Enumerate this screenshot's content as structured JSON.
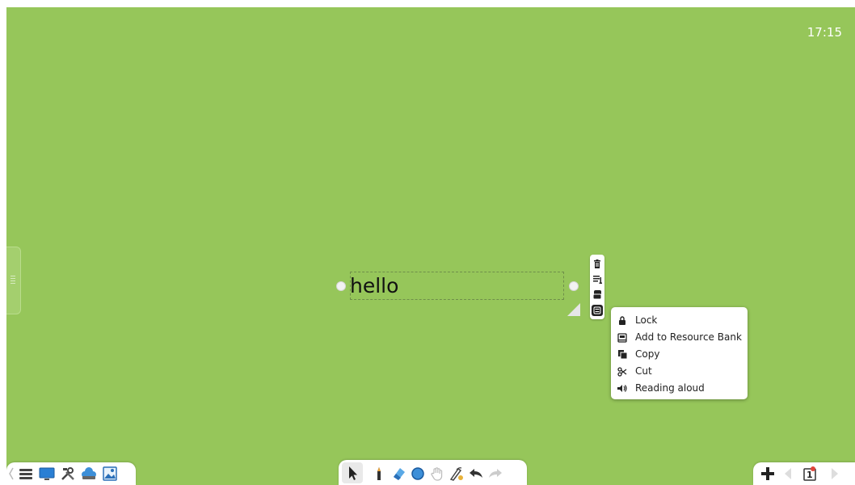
{
  "status": {
    "clock": "17:15"
  },
  "canvas": {
    "background": "#96c65a",
    "text_object": {
      "content": "hello"
    }
  },
  "object_toolbar": {
    "buttons": [
      "trash-icon",
      "text-format-icon",
      "layer-icon",
      "menu-icon"
    ]
  },
  "context_menu": {
    "items": [
      {
        "label": "Lock",
        "icon": "lock-icon"
      },
      {
        "label": "Add to Resource Bank",
        "icon": "resource-bank-icon"
      },
      {
        "label": "Copy",
        "icon": "copy-icon"
      },
      {
        "label": "Cut",
        "icon": "scissors-icon"
      },
      {
        "label": "Reading aloud",
        "icon": "speaker-icon"
      }
    ]
  },
  "bottom_left_toolbar": [
    "collapse-left-icon",
    "menu-icon",
    "screen-icon",
    "tools-icon",
    "cloud-icon",
    "image-icon"
  ],
  "bottom_center_toolbar": [
    "select-icon",
    "pen-icon",
    "eraser-icon",
    "shape-icon",
    "hand-icon",
    "magic-pen-icon",
    "undo-icon",
    "redo-icon"
  ],
  "bottom_right_toolbar": {
    "page_number": "1",
    "icons": [
      "add-page-icon",
      "prev-page-icon",
      "page-icon",
      "next-page-icon"
    ]
  }
}
